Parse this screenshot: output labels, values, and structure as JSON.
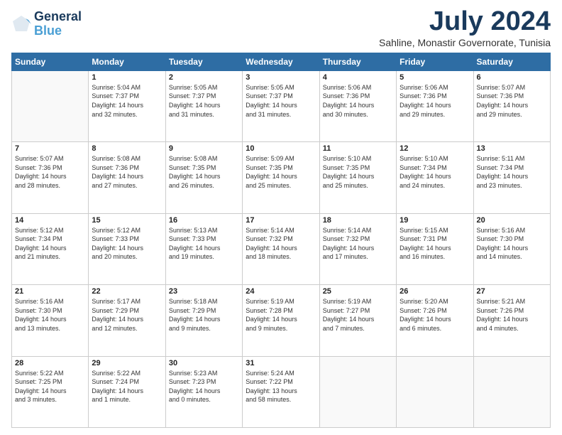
{
  "header": {
    "logo_line1": "General",
    "logo_line2": "Blue",
    "month": "July 2024",
    "location": "Sahline, Monastir Governorate, Tunisia"
  },
  "weekdays": [
    "Sunday",
    "Monday",
    "Tuesday",
    "Wednesday",
    "Thursday",
    "Friday",
    "Saturday"
  ],
  "weeks": [
    [
      {
        "day": "",
        "sunrise": "",
        "sunset": "",
        "daylight": ""
      },
      {
        "day": "1",
        "sunrise": "Sunrise: 5:04 AM",
        "sunset": "Sunset: 7:37 PM",
        "daylight": "Daylight: 14 hours and 32 minutes."
      },
      {
        "day": "2",
        "sunrise": "Sunrise: 5:05 AM",
        "sunset": "Sunset: 7:37 PM",
        "daylight": "Daylight: 14 hours and 31 minutes."
      },
      {
        "day": "3",
        "sunrise": "Sunrise: 5:05 AM",
        "sunset": "Sunset: 7:37 PM",
        "daylight": "Daylight: 14 hours and 31 minutes."
      },
      {
        "day": "4",
        "sunrise": "Sunrise: 5:06 AM",
        "sunset": "Sunset: 7:36 PM",
        "daylight": "Daylight: 14 hours and 30 minutes."
      },
      {
        "day": "5",
        "sunrise": "Sunrise: 5:06 AM",
        "sunset": "Sunset: 7:36 PM",
        "daylight": "Daylight: 14 hours and 29 minutes."
      },
      {
        "day": "6",
        "sunrise": "Sunrise: 5:07 AM",
        "sunset": "Sunset: 7:36 PM",
        "daylight": "Daylight: 14 hours and 29 minutes."
      }
    ],
    [
      {
        "day": "7",
        "sunrise": "Sunrise: 5:07 AM",
        "sunset": "Sunset: 7:36 PM",
        "daylight": "Daylight: 14 hours and 28 minutes."
      },
      {
        "day": "8",
        "sunrise": "Sunrise: 5:08 AM",
        "sunset": "Sunset: 7:36 PM",
        "daylight": "Daylight: 14 hours and 27 minutes."
      },
      {
        "day": "9",
        "sunrise": "Sunrise: 5:08 AM",
        "sunset": "Sunset: 7:35 PM",
        "daylight": "Daylight: 14 hours and 26 minutes."
      },
      {
        "day": "10",
        "sunrise": "Sunrise: 5:09 AM",
        "sunset": "Sunset: 7:35 PM",
        "daylight": "Daylight: 14 hours and 25 minutes."
      },
      {
        "day": "11",
        "sunrise": "Sunrise: 5:10 AM",
        "sunset": "Sunset: 7:35 PM",
        "daylight": "Daylight: 14 hours and 25 minutes."
      },
      {
        "day": "12",
        "sunrise": "Sunrise: 5:10 AM",
        "sunset": "Sunset: 7:34 PM",
        "daylight": "Daylight: 14 hours and 24 minutes."
      },
      {
        "day": "13",
        "sunrise": "Sunrise: 5:11 AM",
        "sunset": "Sunset: 7:34 PM",
        "daylight": "Daylight: 14 hours and 23 minutes."
      }
    ],
    [
      {
        "day": "14",
        "sunrise": "Sunrise: 5:12 AM",
        "sunset": "Sunset: 7:34 PM",
        "daylight": "Daylight: 14 hours and 21 minutes."
      },
      {
        "day": "15",
        "sunrise": "Sunrise: 5:12 AM",
        "sunset": "Sunset: 7:33 PM",
        "daylight": "Daylight: 14 hours and 20 minutes."
      },
      {
        "day": "16",
        "sunrise": "Sunrise: 5:13 AM",
        "sunset": "Sunset: 7:33 PM",
        "daylight": "Daylight: 14 hours and 19 minutes."
      },
      {
        "day": "17",
        "sunrise": "Sunrise: 5:14 AM",
        "sunset": "Sunset: 7:32 PM",
        "daylight": "Daylight: 14 hours and 18 minutes."
      },
      {
        "day": "18",
        "sunrise": "Sunrise: 5:14 AM",
        "sunset": "Sunset: 7:32 PM",
        "daylight": "Daylight: 14 hours and 17 minutes."
      },
      {
        "day": "19",
        "sunrise": "Sunrise: 5:15 AM",
        "sunset": "Sunset: 7:31 PM",
        "daylight": "Daylight: 14 hours and 16 minutes."
      },
      {
        "day": "20",
        "sunrise": "Sunrise: 5:16 AM",
        "sunset": "Sunset: 7:30 PM",
        "daylight": "Daylight: 14 hours and 14 minutes."
      }
    ],
    [
      {
        "day": "21",
        "sunrise": "Sunrise: 5:16 AM",
        "sunset": "Sunset: 7:30 PM",
        "daylight": "Daylight: 14 hours and 13 minutes."
      },
      {
        "day": "22",
        "sunrise": "Sunrise: 5:17 AM",
        "sunset": "Sunset: 7:29 PM",
        "daylight": "Daylight: 14 hours and 12 minutes."
      },
      {
        "day": "23",
        "sunrise": "Sunrise: 5:18 AM",
        "sunset": "Sunset: 7:29 PM",
        "daylight": "Daylight: 14 hours and 9 minutes."
      },
      {
        "day": "24",
        "sunrise": "Sunrise: 5:19 AM",
        "sunset": "Sunset: 7:28 PM",
        "daylight": "Daylight: 14 hours and 9 minutes."
      },
      {
        "day": "25",
        "sunrise": "Sunrise: 5:19 AM",
        "sunset": "Sunset: 7:27 PM",
        "daylight": "Daylight: 14 hours and 7 minutes."
      },
      {
        "day": "26",
        "sunrise": "Sunrise: 5:20 AM",
        "sunset": "Sunset: 7:26 PM",
        "daylight": "Daylight: 14 hours and 6 minutes."
      },
      {
        "day": "27",
        "sunrise": "Sunrise: 5:21 AM",
        "sunset": "Sunset: 7:26 PM",
        "daylight": "Daylight: 14 hours and 4 minutes."
      }
    ],
    [
      {
        "day": "28",
        "sunrise": "Sunrise: 5:22 AM",
        "sunset": "Sunset: 7:25 PM",
        "daylight": "Daylight: 14 hours and 3 minutes."
      },
      {
        "day": "29",
        "sunrise": "Sunrise: 5:22 AM",
        "sunset": "Sunset: 7:24 PM",
        "daylight": "Daylight: 14 hours and 1 minute."
      },
      {
        "day": "30",
        "sunrise": "Sunrise: 5:23 AM",
        "sunset": "Sunset: 7:23 PM",
        "daylight": "Daylight: 14 hours and 0 minutes."
      },
      {
        "day": "31",
        "sunrise": "Sunrise: 5:24 AM",
        "sunset": "Sunset: 7:22 PM",
        "daylight": "Daylight: 13 hours and 58 minutes."
      },
      {
        "day": "",
        "sunrise": "",
        "sunset": "",
        "daylight": ""
      },
      {
        "day": "",
        "sunrise": "",
        "sunset": "",
        "daylight": ""
      },
      {
        "day": "",
        "sunrise": "",
        "sunset": "",
        "daylight": ""
      }
    ]
  ]
}
